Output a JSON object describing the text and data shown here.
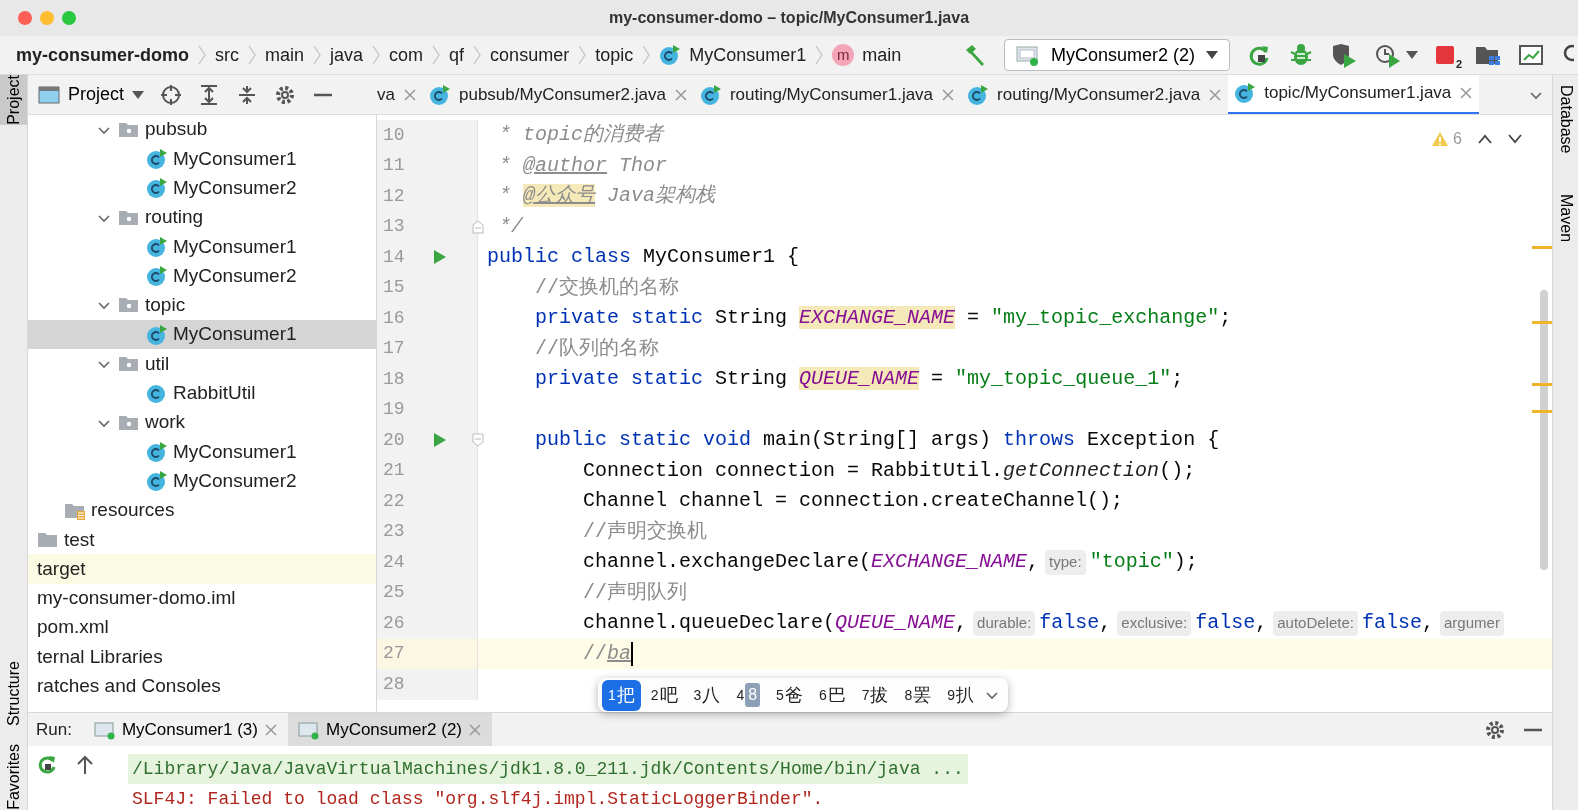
{
  "window": {
    "title": "my-consumer-domo – topic/MyConsumer1.java"
  },
  "breadcrumbs": [
    {
      "label": "my-consumer-domo",
      "kind": "project"
    },
    {
      "label": "src",
      "kind": "folder"
    },
    {
      "label": "main",
      "kind": "folder"
    },
    {
      "label": "java",
      "kind": "folder"
    },
    {
      "label": "com",
      "kind": "folder"
    },
    {
      "label": "qf",
      "kind": "folder"
    },
    {
      "label": "consumer",
      "kind": "folder"
    },
    {
      "label": "topic",
      "kind": "folder"
    },
    {
      "label": "MyConsumer1",
      "kind": "class"
    },
    {
      "label": "main",
      "kind": "method",
      "badge": "m"
    }
  ],
  "run_config": {
    "label": "MyConsumer2 (2)"
  },
  "stop_count": "2",
  "left_stripe": [
    {
      "label": "Project",
      "selected": true
    },
    {
      "label": "Structure",
      "selected": false
    },
    {
      "label": "Favorites",
      "selected": false
    }
  ],
  "right_stripe": [
    {
      "label": "Database"
    },
    {
      "label": "Maven"
    }
  ],
  "project_panel": {
    "title": "Project",
    "tree": [
      {
        "label": "pubsub",
        "kind": "package",
        "expanded": true,
        "selected": false,
        "children": [
          {
            "label": "MyConsumer1",
            "kind": "runnable-class",
            "selected": false
          },
          {
            "label": "MyConsumer2",
            "kind": "runnable-class",
            "selected": false
          }
        ]
      },
      {
        "label": "routing",
        "kind": "package",
        "expanded": true,
        "selected": false,
        "children": [
          {
            "label": "MyConsumer1",
            "kind": "runnable-class",
            "selected": false
          },
          {
            "label": "MyConsumer2",
            "kind": "runnable-class",
            "selected": false
          }
        ]
      },
      {
        "label": "topic",
        "kind": "package",
        "expanded": true,
        "selected": false,
        "children": [
          {
            "label": "MyConsumer1",
            "kind": "runnable-class",
            "selected": true
          }
        ]
      },
      {
        "label": "util",
        "kind": "package",
        "expanded": true,
        "selected": false,
        "children": [
          {
            "label": "RabbitUtil",
            "kind": "class",
            "selected": false
          }
        ]
      },
      {
        "label": "work",
        "kind": "package",
        "expanded": true,
        "selected": false,
        "children": [
          {
            "label": "MyConsumer1",
            "kind": "runnable-class",
            "selected": false
          },
          {
            "label": "MyConsumer2",
            "kind": "runnable-class",
            "selected": false
          }
        ]
      },
      {
        "label": "resources",
        "kind": "resources",
        "selected": false
      },
      {
        "label": "test",
        "kind": "folder",
        "selected": false
      },
      {
        "label": "target",
        "kind": "excluded",
        "selected": false
      },
      {
        "label": "my-consumer-domo.iml",
        "kind": "file",
        "selected": false
      },
      {
        "label": "pom.xml",
        "kind": "file",
        "selected": false
      },
      {
        "label": "ternal Libraries",
        "kind": "file",
        "selected": false
      },
      {
        "label": "ratches and Consoles",
        "kind": "file",
        "selected": false
      }
    ]
  },
  "tabs": [
    {
      "label": "va",
      "kind": "cut",
      "selected": false
    },
    {
      "label": "pubsub/MyConsumer2.java",
      "kind": "class",
      "selected": false
    },
    {
      "label": "routing/MyConsumer1.java",
      "kind": "class",
      "selected": false
    },
    {
      "label": "routing/MyConsumer2.java",
      "kind": "class",
      "selected": false
    },
    {
      "label": "topic/MyConsumer1.java",
      "kind": "class",
      "selected": true
    }
  ],
  "editor": {
    "warning_count": "6",
    "lines": [
      {
        "number": "10",
        "kind": "plain",
        "runnable": false,
        "current": false,
        "tokens": [
          {
            "kind": "doc",
            "text": " * topic的消费者"
          }
        ]
      },
      {
        "number": "11",
        "kind": "plain",
        "runnable": false,
        "current": false,
        "tokens": [
          {
            "kind": "doc",
            "text": " * "
          },
          {
            "kind": "doctag",
            "text": "@author"
          },
          {
            "kind": "doc",
            "text": " Thor"
          }
        ]
      },
      {
        "number": "12",
        "kind": "plain",
        "runnable": false,
        "current": false,
        "tokens": [
          {
            "kind": "doc",
            "text": " * "
          },
          {
            "kind": "doctaghl",
            "text": "@公众号"
          },
          {
            "kind": "doc",
            "text": " Java架构栈"
          }
        ]
      },
      {
        "number": "13",
        "kind": "fold-end",
        "runnable": false,
        "current": false,
        "tokens": [
          {
            "kind": "doc",
            "text": " */"
          }
        ]
      },
      {
        "number": "14",
        "kind": "plain",
        "runnable": true,
        "current": false,
        "tokens": [
          {
            "kind": "kw",
            "text": "public class "
          },
          {
            "kind": "plain",
            "text": "MyConsumer1 {"
          }
        ]
      },
      {
        "number": "15",
        "kind": "plain",
        "runnable": false,
        "current": false,
        "tokens": [
          {
            "kind": "cmt",
            "text": "    //交换机的名称"
          }
        ]
      },
      {
        "number": "16",
        "kind": "plain",
        "runnable": false,
        "current": false,
        "tokens": [
          {
            "kind": "kw",
            "text": "    private static "
          },
          {
            "kind": "plain",
            "text": "String "
          },
          {
            "kind": "fieldhl",
            "text": "EXCHANGE_NAME"
          },
          {
            "kind": "plain",
            "text": " = "
          },
          {
            "kind": "str",
            "text": "\"my_topic_exchange\""
          },
          {
            "kind": "plain",
            "text": ";"
          }
        ]
      },
      {
        "number": "17",
        "kind": "plain",
        "runnable": false,
        "current": false,
        "tokens": [
          {
            "kind": "cmt",
            "text": "    //队列的名称"
          }
        ]
      },
      {
        "number": "18",
        "kind": "plain",
        "runnable": false,
        "current": false,
        "tokens": [
          {
            "kind": "kw",
            "text": "    private static "
          },
          {
            "kind": "plain",
            "text": "String "
          },
          {
            "kind": "fieldhl",
            "text": "QUEUE_NAME"
          },
          {
            "kind": "plain",
            "text": " = "
          },
          {
            "kind": "str",
            "text": "\"my_topic_queue_1\""
          },
          {
            "kind": "plain",
            "text": ";"
          }
        ]
      },
      {
        "number": "19",
        "kind": "plain",
        "runnable": false,
        "current": false
      },
      {
        "number": "20",
        "kind": "fold-start",
        "runnable": true,
        "current": false,
        "tokens": [
          {
            "kind": "kw",
            "text": "    public static void "
          },
          {
            "kind": "plain",
            "text": "main(String[] args) "
          },
          {
            "kind": "kw",
            "text": "throws "
          },
          {
            "kind": "plain",
            "text": "Exception {"
          }
        ]
      },
      {
        "number": "21",
        "kind": "plain",
        "runnable": false,
        "current": false,
        "tokens": [
          {
            "kind": "plain",
            "text": "        Connection connection = RabbitUtil."
          },
          {
            "kind": "call",
            "text": "getConnection"
          },
          {
            "kind": "plain",
            "text": "();"
          }
        ]
      },
      {
        "number": "22",
        "kind": "plain",
        "runnable": false,
        "current": false,
        "tokens": [
          {
            "kind": "plain",
            "text": "        Channel channel = connection.createChannel();"
          }
        ]
      },
      {
        "number": "23",
        "kind": "plain",
        "runnable": false,
        "current": false,
        "tokens": [
          {
            "kind": "cmt",
            "text": "        //声明交换机"
          }
        ]
      },
      {
        "number": "24",
        "kind": "plain",
        "runnable": false,
        "current": false,
        "tokens": [
          {
            "kind": "plain",
            "text": "        channel.exchangeDeclare("
          },
          {
            "kind": "field",
            "text": "EXCHANGE_NAME"
          },
          {
            "kind": "plain",
            "text": ","
          },
          {
            "kind": "hint",
            "text": "type:"
          },
          {
            "kind": "str",
            "text": "\"topic\""
          },
          {
            "kind": "plain",
            "text": ");"
          }
        ]
      },
      {
        "number": "25",
        "kind": "plain",
        "runnable": false,
        "current": false,
        "tokens": [
          {
            "kind": "cmt",
            "text": "        //声明队列"
          }
        ]
      },
      {
        "number": "26",
        "kind": "plain",
        "runnable": false,
        "current": false,
        "tokens": [
          {
            "kind": "plain",
            "text": "        channel.queueDeclare("
          },
          {
            "kind": "field",
            "text": "QUEUE_NAME"
          },
          {
            "kind": "plain",
            "text": ","
          },
          {
            "kind": "hint",
            "text": "durable:"
          },
          {
            "kind": "kw",
            "text": "false"
          },
          {
            "kind": "plain",
            "text": ","
          },
          {
            "kind": "hint",
            "text": "exclusive:"
          },
          {
            "kind": "kw",
            "text": "false"
          },
          {
            "kind": "plain",
            "text": ","
          },
          {
            "kind": "hint",
            "text": "autoDelete:"
          },
          {
            "kind": "kw",
            "text": "false"
          },
          {
            "kind": "plain",
            "text": ","
          },
          {
            "kind": "hint",
            "text": "argumer"
          }
        ]
      },
      {
        "number": "27",
        "kind": "plain",
        "runnable": false,
        "current": true,
        "tokens": [
          {
            "kind": "cmt",
            "text": "        //"
          },
          {
            "kind": "compose",
            "text": "ba"
          }
        ]
      },
      {
        "number": "28",
        "kind": "plain",
        "runnable": false,
        "current": false
      }
    ]
  },
  "ime": {
    "candidates": [
      {
        "number": "1",
        "text": "把",
        "kind": "char",
        "selected": true
      },
      {
        "number": "2",
        "text": "吧",
        "kind": "char",
        "selected": false
      },
      {
        "number": "3",
        "text": "八",
        "kind": "char",
        "selected": false
      },
      {
        "number": "4",
        "text": "8",
        "kind": "boxed",
        "selected": false
      },
      {
        "number": "5",
        "text": "爸",
        "kind": "char",
        "selected": false
      },
      {
        "number": "6",
        "text": "巴",
        "kind": "char",
        "selected": false
      },
      {
        "number": "7",
        "text": "拔",
        "kind": "char",
        "selected": false
      },
      {
        "number": "8",
        "text": "罢",
        "kind": "char",
        "selected": false
      },
      {
        "number": "9",
        "text": "扒",
        "kind": "char",
        "selected": false
      }
    ]
  },
  "run_panel": {
    "label": "Run:",
    "tabs": [
      {
        "label": "MyConsumer1 (3)",
        "selected": false
      },
      {
        "label": "MyConsumer2 (2)",
        "selected": true
      }
    ],
    "output": [
      {
        "text": "/Library/Java/JavaVirtualMachines/jdk1.8.0_211.jdk/Contents/Home/bin/java ...",
        "kind": "command"
      },
      {
        "text": "SLF4J: Failed to load class \"org.slf4j.impl.StaticLoggerBinder\".",
        "kind": "error"
      }
    ]
  }
}
